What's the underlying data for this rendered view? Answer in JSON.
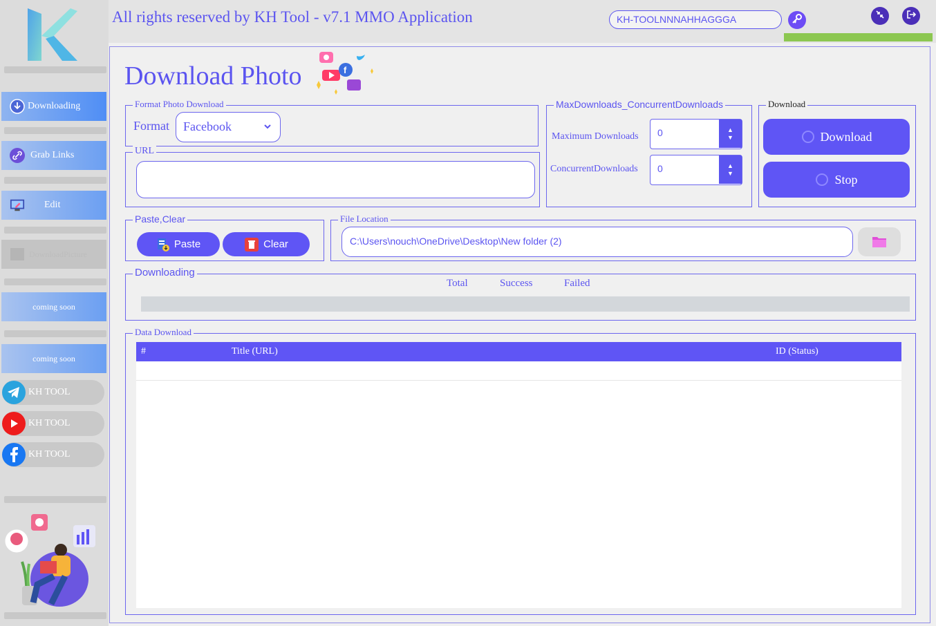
{
  "header": {
    "title": "All rights reserved by KH Tool - v7.1 MMO Application",
    "license_key": "KH-TOOLNNNAHHAGGGA"
  },
  "sidebar": {
    "items": [
      {
        "label": "Downloading",
        "icon": "download-circle-icon"
      },
      {
        "label": "Grab Links",
        "icon": "link-icon"
      },
      {
        "label": "Edit",
        "icon": "monitor-edit-icon"
      },
      {
        "label": "DownloadPicture",
        "icon": "picture-icon"
      },
      {
        "label": "coming soon"
      },
      {
        "label": "coming soon"
      }
    ],
    "socials": [
      {
        "label": "KH TOOL",
        "icon": "telegram-icon"
      },
      {
        "label": "KH TOOL",
        "icon": "youtube-icon"
      },
      {
        "label": "KH TOOL",
        "icon": "facebook-icon"
      }
    ]
  },
  "main": {
    "page_title": "Download Photo",
    "format_group": {
      "legend": "Format Photo Download",
      "label": "Format",
      "selected": "Facebook"
    },
    "url_group": {
      "legend": "URL",
      "value": ""
    },
    "max_group": {
      "legend": "MaxDownloads_ConcurrentDownloads",
      "max_label": "Maximum Downloads",
      "max_value": "0",
      "concurrent_label": "ConcurrentDownloads",
      "concurrent_value": "0"
    },
    "download_group": {
      "legend": "Download",
      "download_label": "Download",
      "stop_label": "Stop"
    },
    "paste_group": {
      "legend": "Paste,Clear",
      "paste_label": "Paste",
      "clear_label": "Clear"
    },
    "file_group": {
      "legend": "File Location",
      "path": "C:\\Users\\nouch\\OneDrive\\Desktop\\New folder (2)"
    },
    "progress_group": {
      "legend": "Downloading",
      "total_label": "Total",
      "success_label": "Success",
      "failed_label": "Failed",
      "progress": 0
    },
    "table_group": {
      "legend": "Data Download",
      "columns": [
        "#",
        "Title (URL)",
        "ID (Status)"
      ],
      "rows": []
    }
  },
  "colors": {
    "accent": "#5f55f5",
    "text": "#5b54f0",
    "progress_green": "#8cc751"
  }
}
